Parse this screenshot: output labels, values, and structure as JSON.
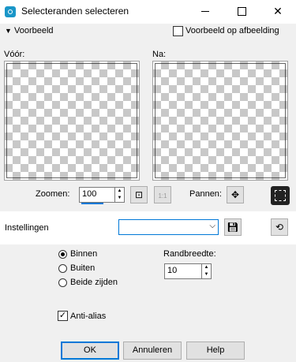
{
  "window": {
    "title": "Selecteranden selecteren",
    "minimize_icon": "minimize-icon",
    "maximize_icon": "maximize-icon",
    "close_glyph": "✕"
  },
  "preview_toggle": {
    "label": "Voorbeeld",
    "expanded": true
  },
  "preview_on_image": {
    "label": "Voorbeeld op afbeelding",
    "checked": false
  },
  "before_label": "Vóór:",
  "after_label": "Na:",
  "zoom": {
    "label": "Zoomen:",
    "value": "100"
  },
  "pan": {
    "label": "Pannen:"
  },
  "settings": {
    "label": "Instellingen",
    "value": ""
  },
  "options": [
    {
      "label": "Binnen",
      "selected": true
    },
    {
      "label": "Buiten",
      "selected": false
    },
    {
      "label": "Beide zijden",
      "selected": false
    }
  ],
  "border_width": {
    "label": "Randbreedte:",
    "value": "10"
  },
  "anti_alias": {
    "label": "Anti-alias",
    "checked": true
  },
  "buttons": {
    "ok": "OK",
    "cancel": "Annuleren",
    "help": "Help"
  },
  "colors": {
    "accent": "#0078d7",
    "app_icon": "#1a96c8"
  }
}
